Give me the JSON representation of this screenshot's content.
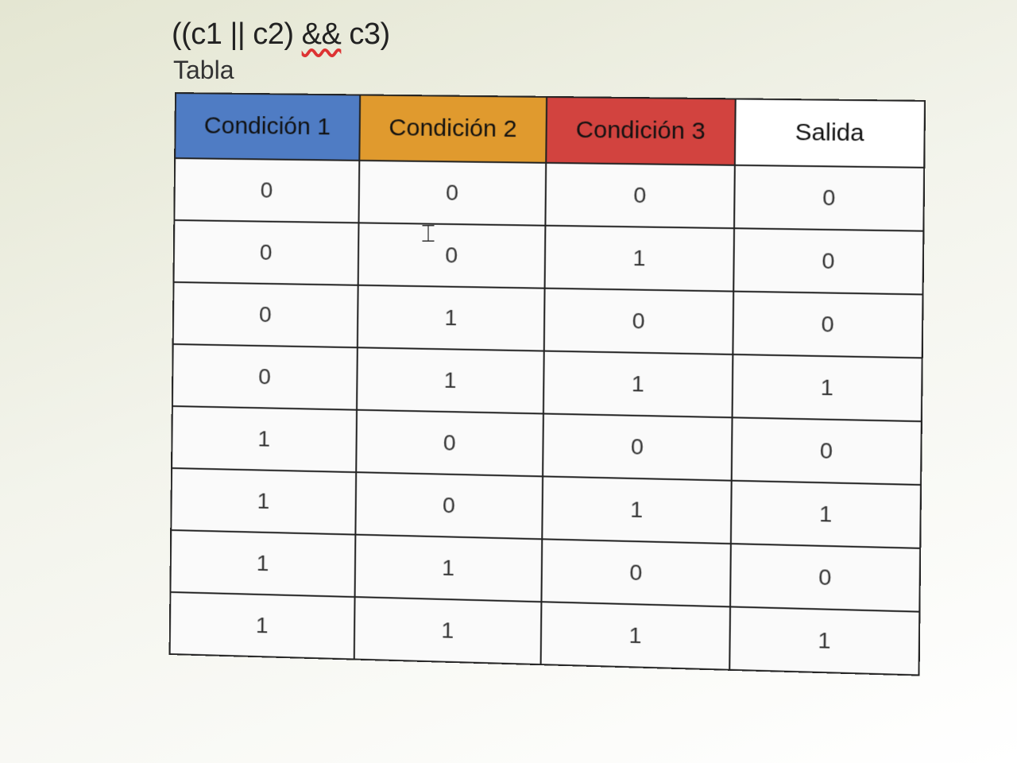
{
  "expression": {
    "part1": "((c1 || c2) ",
    "operator": "&&",
    "part2": " c3)"
  },
  "caption": "Tabla",
  "table": {
    "headers": [
      {
        "label": "Condición 1",
        "color": "#4f7cc4"
      },
      {
        "label": "Condición 2",
        "color": "#e09a2e"
      },
      {
        "label": "Condición 3",
        "color": "#d2433f"
      },
      {
        "label": "Salida",
        "color": "#ffffff"
      }
    ],
    "rows": [
      [
        "0",
        "0",
        "0",
        "0"
      ],
      [
        "0",
        "0",
        "1",
        "0"
      ],
      [
        "0",
        "1",
        "0",
        "0"
      ],
      [
        "0",
        "1",
        "1",
        "1"
      ],
      [
        "1",
        "0",
        "0",
        "0"
      ],
      [
        "1",
        "0",
        "1",
        "1"
      ],
      [
        "1",
        "1",
        "0",
        "0"
      ],
      [
        "1",
        "1",
        "1",
        "1"
      ]
    ]
  }
}
